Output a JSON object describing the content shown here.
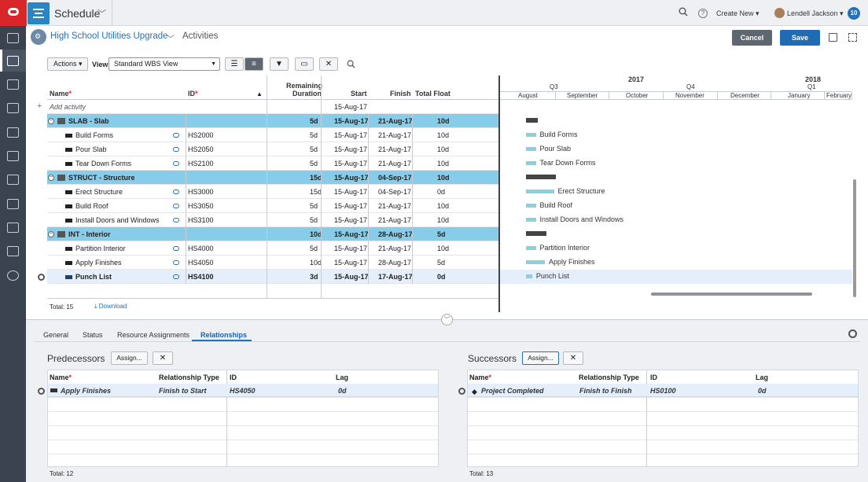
{
  "app": {
    "title": "Schedule",
    "create_new": "Create New",
    "user": "Lendell Jackson",
    "notifications": "10"
  },
  "page": {
    "project": "High School Utilities Upgrade",
    "title": "Activities",
    "cancel": "Cancel",
    "save": "Save"
  },
  "toolbar": {
    "actions": "Actions",
    "view_label": "View",
    "view_value": "Standard WBS View"
  },
  "grid": {
    "headers": {
      "name": "Name",
      "id": "ID",
      "remaining": "Remaining",
      "duration": "Duration",
      "start": "Start",
      "finish": "Finish",
      "total_float": "Total Float"
    },
    "add_activity": "Add activity",
    "add_start": "15-Aug-17",
    "rows": [
      {
        "type": "wbs",
        "name": "SLAB - Slab",
        "id": "",
        "dur": "5d",
        "start": "15-Aug-17",
        "finish": "21-Aug-17",
        "float": "10d"
      },
      {
        "type": "act",
        "name": "Build Forms",
        "id": "HS2000",
        "dur": "5d",
        "start": "15-Aug-17",
        "finish": "21-Aug-17",
        "float": "10d"
      },
      {
        "type": "act",
        "name": "Pour Slab",
        "id": "HS2050",
        "dur": "5d",
        "start": "15-Aug-17",
        "finish": "21-Aug-17",
        "float": "10d"
      },
      {
        "type": "act",
        "name": "Tear Down Forms",
        "id": "HS2100",
        "dur": "5d",
        "start": "15-Aug-17",
        "finish": "21-Aug-17",
        "float": "10d"
      },
      {
        "type": "wbs",
        "name": "STRUCT - Structure",
        "id": "",
        "dur": "15d",
        "start": "15-Aug-17",
        "finish": "04-Sep-17",
        "float": "10d"
      },
      {
        "type": "act",
        "name": "Erect Structure",
        "id": "HS3000",
        "dur": "15d",
        "start": "15-Aug-17",
        "finish": "04-Sep-17",
        "float": "0d"
      },
      {
        "type": "act",
        "name": "Build Roof",
        "id": "HS3050",
        "dur": "5d",
        "start": "15-Aug-17",
        "finish": "21-Aug-17",
        "float": "10d"
      },
      {
        "type": "act",
        "name": "Install Doors and Windows",
        "id": "HS3100",
        "dur": "5d",
        "start": "15-Aug-17",
        "finish": "21-Aug-17",
        "float": "10d"
      },
      {
        "type": "wbs",
        "name": "INT - Interior",
        "id": "",
        "dur": "10d",
        "start": "15-Aug-17",
        "finish": "28-Aug-17",
        "float": "5d"
      },
      {
        "type": "act",
        "name": "Partition Interior",
        "id": "HS4000",
        "dur": "5d",
        "start": "15-Aug-17",
        "finish": "21-Aug-17",
        "float": "10d"
      },
      {
        "type": "act",
        "name": "Apply Finishes",
        "id": "HS4050",
        "dur": "10d",
        "start": "15-Aug-17",
        "finish": "28-Aug-17",
        "float": "5d"
      },
      {
        "type": "sel",
        "name": "Punch List",
        "id": "HS4100",
        "dur": "3d",
        "start": "15-Aug-17",
        "finish": "17-Aug-17",
        "float": "0d"
      }
    ],
    "total": "Total:  15",
    "download": "Download"
  },
  "gantt": {
    "year1": "2017",
    "year2": "2018",
    "q3": "Q3",
    "q4": "Q4",
    "q1": "Q1",
    "months": [
      "August",
      "September",
      "October",
      "November",
      "December",
      "January",
      "February"
    ]
  },
  "bottom": {
    "tabs": [
      "General",
      "Status",
      "Resource Assignments",
      "Relationships"
    ],
    "pred_title": "Predecessors",
    "succ_title": "Successors",
    "assign": "Assign...",
    "rel_headers": {
      "name": "Name",
      "type": "Relationship Type",
      "id": "ID",
      "lag": "Lag"
    },
    "pred": {
      "name": "Apply Finishes",
      "type": "Finish to Start",
      "id": "HS4050",
      "lag": "0d",
      "total": "Total:  12"
    },
    "succ": {
      "name": "Project Completed",
      "type": "Finish to Finish",
      "id": "HS0100",
      "lag": "0d",
      "total": "Total:  13"
    }
  }
}
